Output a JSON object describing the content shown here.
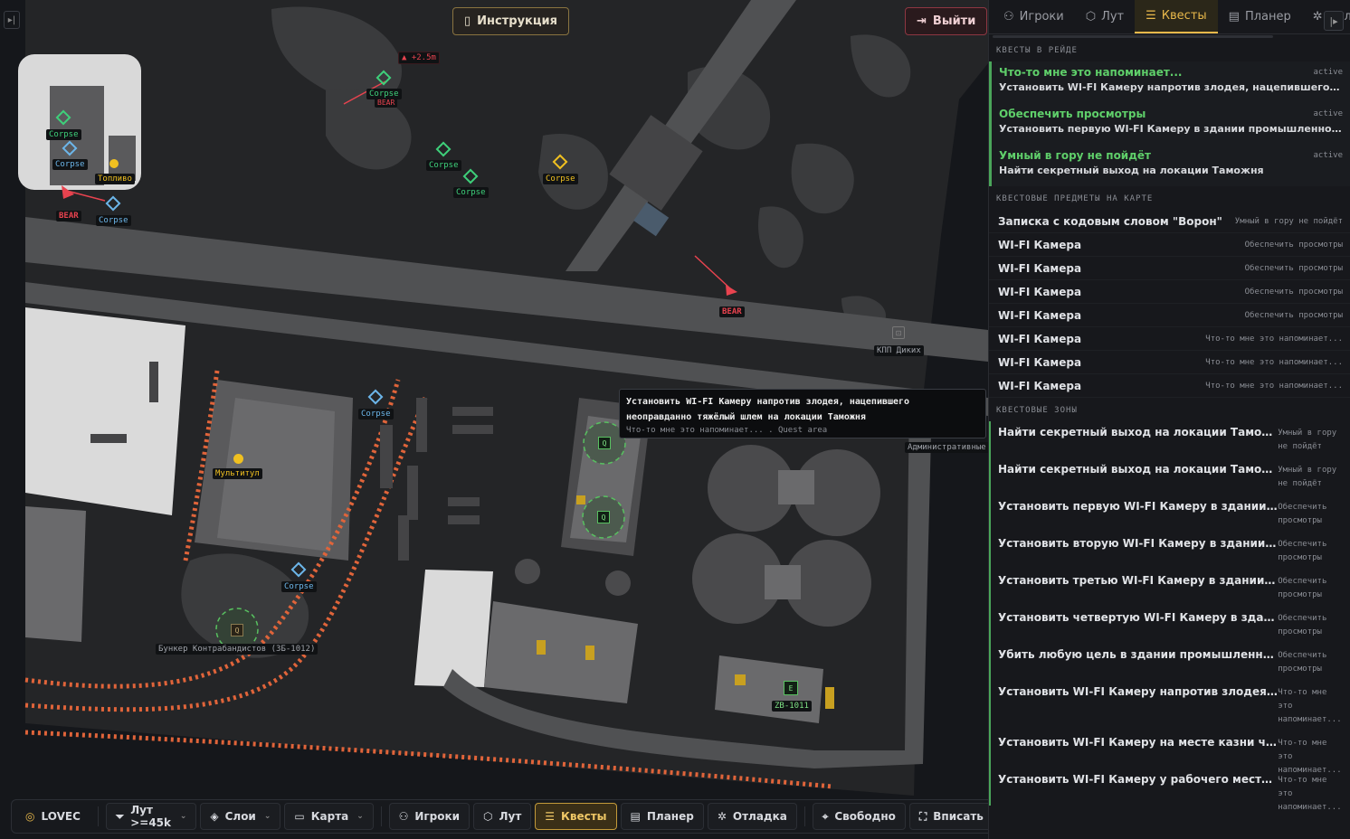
{
  "top": {
    "instruction_label": "Инструкция",
    "exit_label": "Выйти"
  },
  "map": {
    "elevation": "▲ +2.5m",
    "markers": {
      "corpse": "Corpse",
      "bear": "BEAR",
      "fuel": "Топливо",
      "multitool": "Мультитул",
      "bunker": "Бункер Контрабандистов (ЗБ-1012)",
      "zb1011": "ZB-1011",
      "kpp": "КПП Диких",
      "admin": "Административные",
      "q_letter": "Q",
      "e_letter": "E"
    },
    "tooltip": {
      "title": "Установить WI-FI Камеру напротив злодея, нацепившего неоправданно тяжёлый шлем на локации Таможня",
      "sub": "Что-то мне это напоминает... . Quest area"
    }
  },
  "bottom": {
    "location": "LOVEC",
    "loot_filter": "Лут >=45k",
    "layers": "Слои",
    "map": "Карта",
    "players": "Игроки",
    "loot": "Лут",
    "quests": "Квесты",
    "planner": "Планер",
    "debug": "Отладка",
    "free": "Свободно",
    "fit": "Вписать"
  },
  "sidebar": {
    "tabs": [
      "Игроки",
      "Лут",
      "Квесты",
      "Планер",
      "Отладка"
    ],
    "section_raid": "КВЕСТЫ В РЕЙДЕ",
    "section_items": "КВЕСТОВЫЕ ПРЕДМЕТЫ НА КАРТЕ",
    "section_zones": "КВЕСТОВЫЕ ЗОНЫ",
    "raid_quests": [
      {
        "name": "Что-то мне это напоминает...",
        "status": "active",
        "desc": "Установить WI-FI Камеру напротив злодея, нацепившего неоправданно тяжёлый шлем на локации Таможня"
      },
      {
        "name": "Обеспечить просмотры",
        "status": "active",
        "desc": "Установить первую WI-FI Камеру в здании промышленного корпуса на локации Таможня"
      },
      {
        "name": "Умный в гору не пойдёт",
        "status": "active",
        "desc": "Найти секретный выход на локации Таможня"
      }
    ],
    "items": [
      {
        "name": "Записка с кодовым словом \"Ворон\"",
        "quest": "Умный в гору не пойдёт"
      },
      {
        "name": "WI-FI Камера",
        "quest": "Обеспечить просмотры"
      },
      {
        "name": "WI-FI Камера",
        "quest": "Обеспечить просмотры"
      },
      {
        "name": "WI-FI Камера",
        "quest": "Обеспечить просмотры"
      },
      {
        "name": "WI-FI Камера",
        "quest": "Обеспечить просмотры"
      },
      {
        "name": "WI-FI Камера",
        "quest": "Что-то мне это напоминает..."
      },
      {
        "name": "WI-FI Камера",
        "quest": "Что-то мне это напоминает..."
      },
      {
        "name": "WI-FI Камера",
        "quest": "Что-то мне это напоминает..."
      }
    ],
    "zones": [
      {
        "name": "Найти секретный выход на локации Таможня",
        "quest": "Умный в гору не пойдёт"
      },
      {
        "name": "Найти секретный выход на локации Таможня",
        "quest": "Умный в гору не пойдёт"
      },
      {
        "name": "Установить первую WI-FI Камеру в здании промышленного корпуса",
        "quest": "Обеспечить просмотры"
      },
      {
        "name": "Установить вторую WI-FI Камеру в здании промышленного корпуса",
        "quest": "Обеспечить просмотры"
      },
      {
        "name": "Установить третью WI-FI Камеру в здании промышленного корпуса",
        "quest": "Обеспечить просмотры"
      },
      {
        "name": "Установить четвертую WI-FI Камеру в здании промышленного корпуса",
        "quest": "Обеспечить просмотры"
      },
      {
        "name": "Убить любую цель в здании промышленного корпуса",
        "quest": "Обеспечить просмотры"
      },
      {
        "name": "Установить WI-FI Камеру напротив злодея, нацепившего шлем",
        "quest": "Что-то мне это напоминает..."
      },
      {
        "name": "Установить WI-FI Камеру на месте казни членов",
        "quest": "Что-то мне это напоминает..."
      },
      {
        "name": "Установить WI-FI Камеру у рабочего места инженера",
        "quest": "Что-то мне это напоминает..."
      }
    ]
  },
  "colors": {
    "accent": "#e8b84a",
    "quest_green": "#5fcf6a",
    "bear_red": "#e8434f",
    "corpse_green": "#3ed07a",
    "corpse_blue": "#6cb6ea"
  }
}
